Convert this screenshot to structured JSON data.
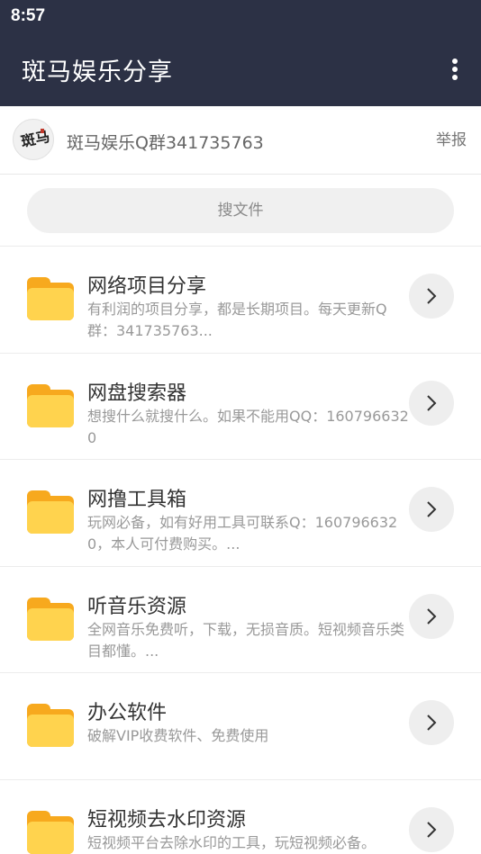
{
  "status_bar": {
    "time": "8:57"
  },
  "app_bar": {
    "title": "斑马娱乐分享",
    "menu_icon": "more-vert-icon"
  },
  "group": {
    "avatar_text": "斑马",
    "name": "斑马娱乐Q群341735763",
    "report_label": "举报"
  },
  "search": {
    "placeholder": "搜文件"
  },
  "items": [
    {
      "title": "网络项目分享",
      "desc": "有利润的项目分享，都是长期项目。每天更新Q群：341735763..."
    },
    {
      "title": "网盘搜索器",
      "desc": "想搜什么就搜什么。如果不能用QQ：1607966320"
    },
    {
      "title": "网撸工具箱",
      "desc": "玩网必备，如有好用工具可联系Q：1607966320，本人可付费购买。..."
    },
    {
      "title": "听音乐资源",
      "desc": "全网音乐免费听，下载，无损音质。短视频音乐类目都懂。..."
    },
    {
      "title": "办公软件",
      "desc": "破解VIP收费软件、免费使用"
    },
    {
      "title": "短视频去水印资源",
      "desc": "短视频平台去除水印的工具，玩短视频必备。"
    }
  ],
  "colors": {
    "header": "#2c3145",
    "folder_front": "#ffd34e",
    "folder_back": "#f7a91e"
  }
}
